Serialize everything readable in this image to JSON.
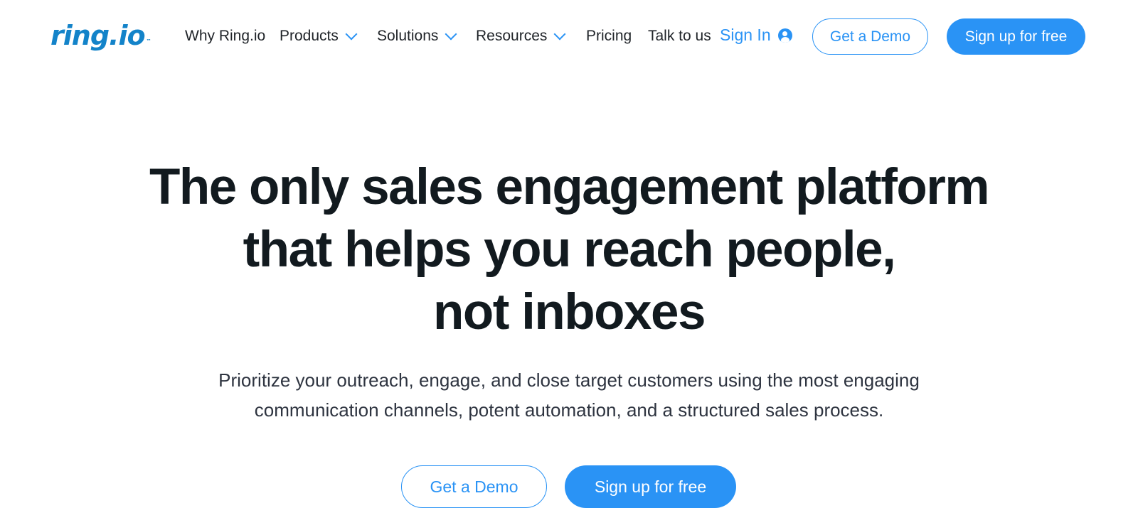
{
  "header": {
    "logo": "ring.io",
    "logo_tm": "™",
    "nav": [
      {
        "label": "Why Ring.io",
        "dropdown": false
      },
      {
        "label": "Products",
        "dropdown": true
      },
      {
        "label": "Solutions",
        "dropdown": true
      },
      {
        "label": "Resources",
        "dropdown": true
      },
      {
        "label": "Pricing",
        "dropdown": false
      },
      {
        "label": "Talk to us",
        "dropdown": false
      }
    ],
    "sign_in": "Sign In",
    "get_demo": "Get a Demo",
    "sign_up": "Sign up for free"
  },
  "hero": {
    "title_lines": [
      "The only sales engagement platform",
      "that helps you reach people,",
      "not inboxes"
    ],
    "subtitle_lines": [
      "Prioritize your outreach, engage, and close target customers using the most engaging",
      "communication channels, potent automation, and a structured sales process."
    ],
    "get_demo": "Get a Demo",
    "sign_up": "Sign up for free"
  },
  "colors": {
    "accent": "#2a93f5",
    "logo": "#1383c9",
    "heading": "#121a1f"
  }
}
